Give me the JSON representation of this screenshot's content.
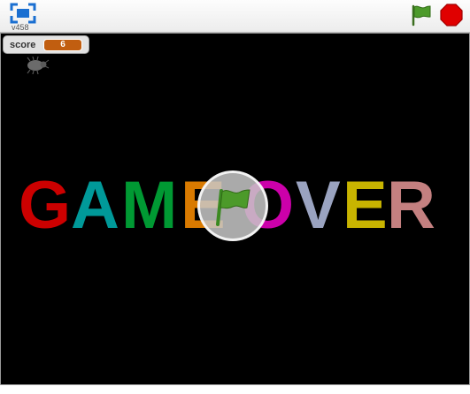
{
  "toolbar": {
    "fullscreen_icon": "fullscreen-icon",
    "version": "v458",
    "green_flag_icon": "green-flag-icon",
    "stop_icon": "stop-sign-icon"
  },
  "monitor": {
    "label": "score",
    "value": "6"
  },
  "stage": {
    "background": "#000000",
    "sprite_icon": "bug-icon",
    "game_over_letters": [
      {
        "char": "G",
        "color": "#cc0000"
      },
      {
        "char": "A",
        "color": "#009999"
      },
      {
        "char": "M",
        "color": "#009933"
      },
      {
        "char": "E",
        "color": "#d97a00"
      },
      {
        "char": "O",
        "color": "#cc00aa"
      },
      {
        "char": "V",
        "color": "#9aa3c0"
      },
      {
        "char": "E",
        "color": "#c8b400"
      },
      {
        "char": "R",
        "color": "#c48080"
      }
    ],
    "play_overlay_icon": "green-flag-icon"
  },
  "colors": {
    "flag_green": "#4c9a2a",
    "stop_red": "#e00000",
    "monitor_value_bg": "#c15e10",
    "fullscreen_blue": "#1a6fd1"
  }
}
